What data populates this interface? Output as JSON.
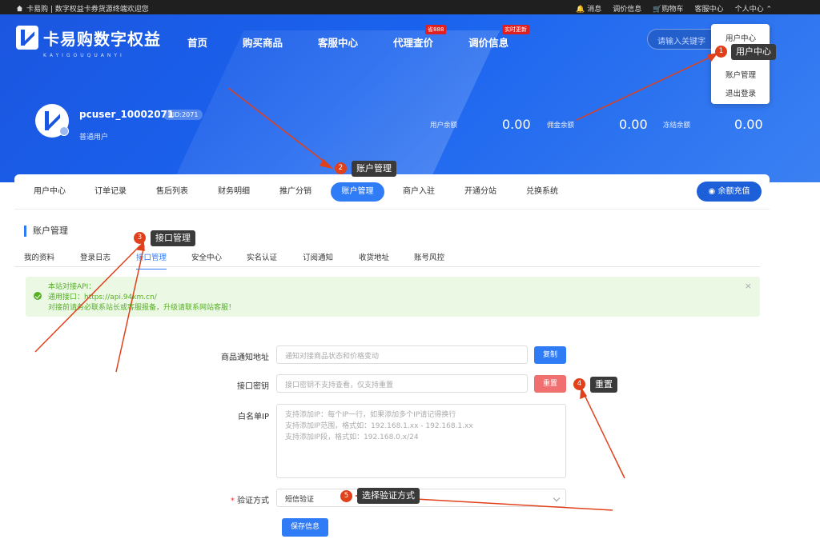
{
  "topbar": {
    "left_text": "卡易购 | 数字权益卡券货源终端欢迎您",
    "links": [
      "消息",
      "调价信息",
      "购物车",
      "客服中心",
      "个人中心"
    ]
  },
  "logo": {
    "text": "卡易购数字权益",
    "sub": "KAYIGOUQUANYI"
  },
  "nav": {
    "items": [
      {
        "label": "首页",
        "badge": ""
      },
      {
        "label": "购买商品",
        "badge": ""
      },
      {
        "label": "客服中心",
        "badge": ""
      },
      {
        "label": "代理查价",
        "badge": "省888"
      },
      {
        "label": "调价信息",
        "badge": "实时更新"
      }
    ]
  },
  "search": {
    "placeholder": "请输入关键字"
  },
  "user": {
    "name": "pcuser_10002071",
    "uid": "UID:2071",
    "type": "普通用户"
  },
  "balances": [
    {
      "label": "用户余额",
      "value": "0.00"
    },
    {
      "label": "佣金余额",
      "value": "0.00"
    },
    {
      "label": "冻结余额",
      "value": "0.00"
    }
  ],
  "dropdown": {
    "items": [
      "用户中心",
      "",
      "账户管理",
      "退出登录"
    ]
  },
  "tabs": [
    "用户中心",
    "订单记录",
    "售后列表",
    "财务明细",
    "推广分销",
    "账户管理",
    "商户入驻",
    "开通分站",
    "兑换系统"
  ],
  "active_tab": "账户管理",
  "recharge_label": "余额充值",
  "section_title": "账户管理",
  "subtabs": [
    "我的资料",
    "登录日志",
    "接口管理",
    "安全中心",
    "实名认证",
    "订阅通知",
    "收货地址",
    "账号风控"
  ],
  "alert": {
    "line1": "本站对接API：",
    "line2": "通用接口：https://api.94km.cn/",
    "line3": "对接前请务必联系站长或客服报备，升级请联系网站客服！",
    "close": "×"
  },
  "form": {
    "notify_label": "商品通知地址",
    "notify_placeholder": "通知对接商品状态和价格变动",
    "copy_label": "复制",
    "key_label": "接口密钥",
    "key_placeholder": "接口密钥不支持查看，仅支持重置",
    "reset_label": "重置",
    "whitelist_label": "白名单IP",
    "whitelist_lines": [
      "支持添加IP：每个IP一行，如果添加多个IP请记得换行",
      "支持添加IP范围，格式如：192.168.1.xx - 192.168.1.xx",
      "支持添加IP段，格式如：192.168.0.x/24"
    ],
    "verify_required": "*",
    "verify_label": "验证方式",
    "verify_value": "短信验证",
    "save_label": "保存信息"
  },
  "annotations": [
    {
      "num": "1",
      "text": "用户中心"
    },
    {
      "num": "2",
      "text": "账户管理"
    },
    {
      "num": "3",
      "text": "接口管理"
    },
    {
      "num": "4",
      "text": "重置"
    },
    {
      "num": "5",
      "text": "选择验证方式"
    }
  ],
  "colors": {
    "primary": "#2f7cf6",
    "hero": "#1b56e0",
    "danger": "#f07070",
    "success": "#57b024",
    "annotation": "#e0401a"
  }
}
